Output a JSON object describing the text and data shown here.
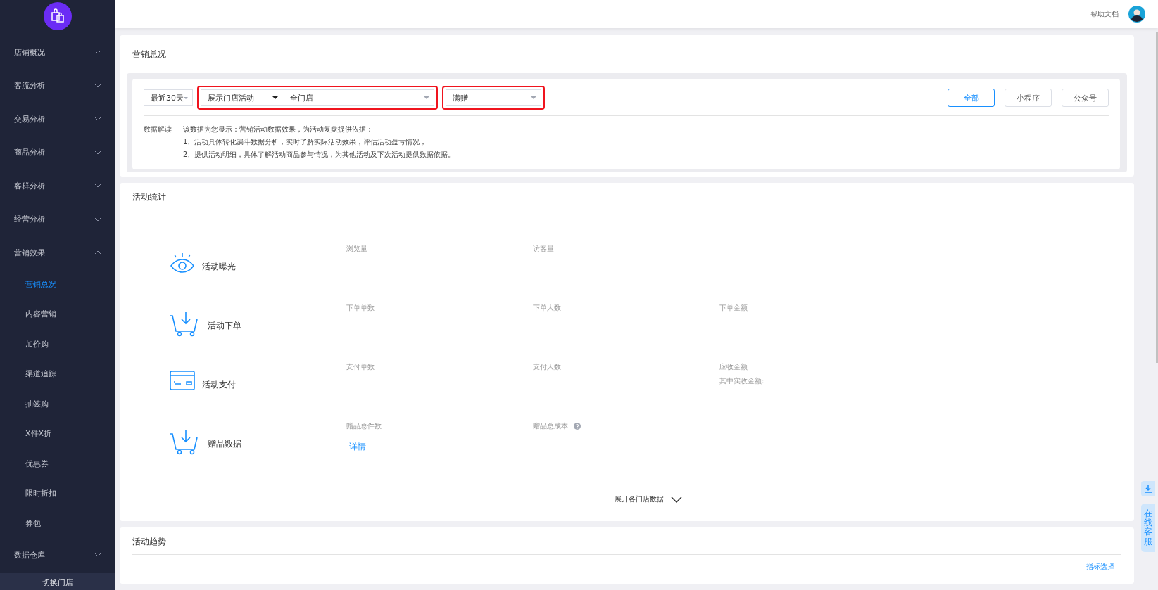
{
  "sidebar": {
    "items": [
      {
        "label": "店铺概况",
        "expanded": false
      },
      {
        "label": "客流分析",
        "expanded": false
      },
      {
        "label": "交易分析",
        "expanded": false
      },
      {
        "label": "商品分析",
        "expanded": false
      },
      {
        "label": "客群分析",
        "expanded": false
      },
      {
        "label": "经营分析",
        "expanded": false
      },
      {
        "label": "营销效果",
        "expanded": true,
        "children": [
          {
            "label": "营销总况",
            "selected": true
          },
          {
            "label": "内容营销",
            "selected": false
          },
          {
            "label": "加价购",
            "selected": false
          },
          {
            "label": "渠道追踪",
            "selected": false
          },
          {
            "label": "抽签购",
            "selected": false
          },
          {
            "label": "X件X折",
            "selected": false
          },
          {
            "label": "优惠券",
            "selected": false
          },
          {
            "label": "限时折扣",
            "selected": false
          },
          {
            "label": "券包",
            "selected": false
          }
        ]
      },
      {
        "label": "数据仓库",
        "expanded": false
      }
    ],
    "footer": "切换门店"
  },
  "topbar": {
    "help_link": "帮助文档"
  },
  "page_title": "营销总况",
  "filters": {
    "date_range": "最近30天",
    "store_group": {
      "highlighted": true,
      "mode": "展示门店活动",
      "store": "全门店"
    },
    "activity_type": {
      "highlighted": true,
      "value": "满赠"
    },
    "channels": [
      {
        "label": "全部",
        "selected": true
      },
      {
        "label": "小程序",
        "selected": false
      },
      {
        "label": "公众号",
        "selected": false
      }
    ]
  },
  "data_note": {
    "label": "数据解读",
    "lines": [
      "该数据为您显示：营销活动数据效果，为活动复盘提供依据：",
      "1、活动具体转化漏斗数据分析，实时了解实际活动效果，评估活动盈亏情况；",
      "2、提供活动明细，具体了解活动商品参与情况，为其他活动及下次活动提供数据依据。"
    ]
  },
  "stats": {
    "title": "活动统计",
    "rows": [
      {
        "kind": "eye",
        "title": "活动曝光",
        "metrics": [
          {
            "label": "浏览量"
          },
          {
            "label": "访客量"
          }
        ]
      },
      {
        "kind": "cart",
        "title": "活动下单",
        "metrics": [
          {
            "label": "下单单数"
          },
          {
            "label": "下单人数"
          },
          {
            "label": "下单金额"
          }
        ]
      },
      {
        "kind": "card",
        "title": "活动支付",
        "metrics": [
          {
            "label": "支付单数"
          },
          {
            "label": "支付人数"
          },
          {
            "label": "应收金额",
            "sub": "其中实收金额:"
          }
        ]
      },
      {
        "kind": "cart",
        "title": "赠品数据",
        "metrics": [
          {
            "label": "赠品总件数",
            "link": "详情"
          },
          {
            "label": "赠品总成本",
            "help": true
          }
        ]
      }
    ],
    "expand": "展开各门店数据"
  },
  "trend": {
    "title": "活动趋势",
    "link": "指标选择"
  },
  "side_tools": {
    "service": "在线客服"
  }
}
